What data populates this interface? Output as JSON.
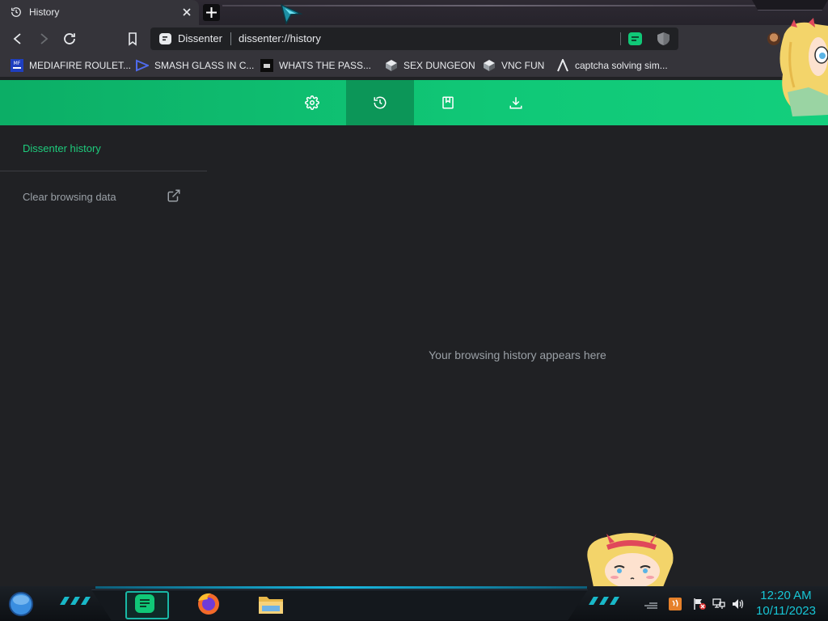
{
  "browser": {
    "tab": {
      "title": "History",
      "icon": "history-icon"
    },
    "omnibox": {
      "site_name": "Dissenter",
      "url": "dissenter://history"
    }
  },
  "bookmarks": [
    {
      "label": "MEDIAFIRE ROULET...",
      "icon": "mediafire-favicon"
    },
    {
      "label": "SMASH GLASS IN C...",
      "icon": "visual-studio-favicon"
    },
    {
      "label": "WHATS THE PASS...",
      "icon": "dark-box-favicon"
    },
    {
      "label": "SEX DUNGEON",
      "icon": "cube-favicon"
    },
    {
      "label": "VNC FUN",
      "icon": "cube-favicon"
    },
    {
      "label": "captcha solving sim...",
      "icon": "arrow-a-favicon"
    }
  ],
  "nav": {
    "tabs": [
      {
        "name": "settings",
        "icon": "gear-icon",
        "active": false
      },
      {
        "name": "history",
        "icon": "history-icon",
        "active": true
      },
      {
        "name": "bookmarks",
        "icon": "bookmark-icon",
        "active": false
      },
      {
        "name": "downloads",
        "icon": "download-icon",
        "active": false
      }
    ]
  },
  "sidebar": {
    "title": "Dissenter history",
    "clear_label": "Clear browsing data"
  },
  "main": {
    "empty_message": "Your browsing history appears here"
  },
  "taskbar": {
    "time": "12:20 AM",
    "date": "10/11/2023"
  },
  "colors": {
    "accent_green": "#10c877",
    "active_tab_green": "#0c9658",
    "page_background": "#202124",
    "clock_cyan": "#17c6d6"
  }
}
